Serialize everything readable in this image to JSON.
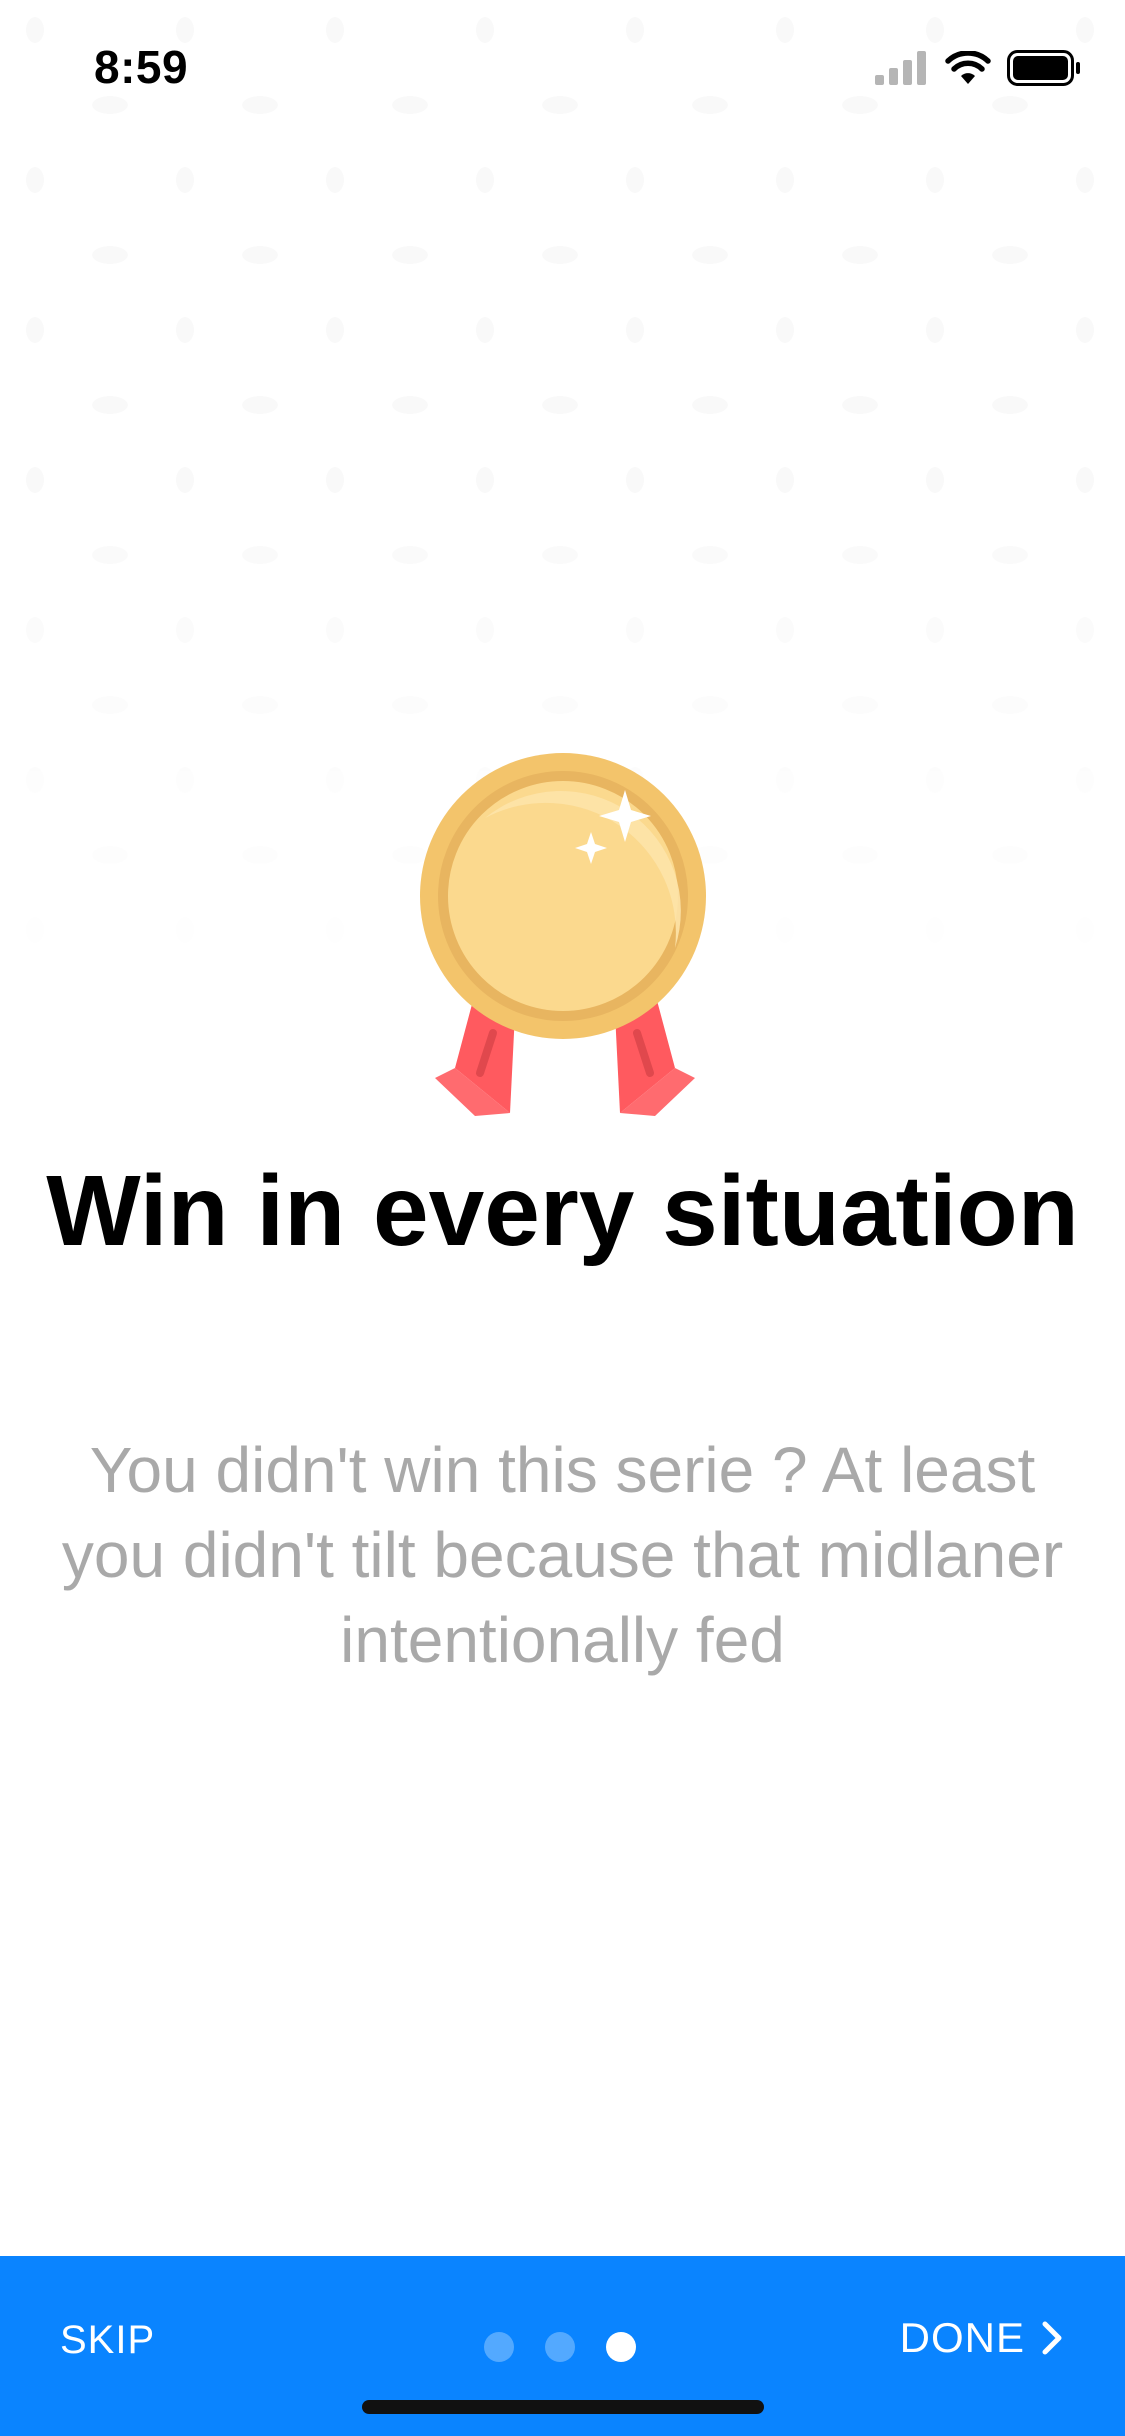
{
  "status_bar": {
    "time": "8:59",
    "icons": [
      "cellular-signal-icon",
      "wifi-icon",
      "battery-icon"
    ]
  },
  "slide": {
    "illustration": "medal-icon",
    "title": "Win in every situation",
    "description": "You didn't win this serie ? At least you didn't tilt because that midlaner intentionally fed"
  },
  "footer": {
    "skip_label": "SKIP",
    "done_label": "DONE",
    "page_count": 3,
    "current_page": 3,
    "background_color": "#0A84FF"
  }
}
